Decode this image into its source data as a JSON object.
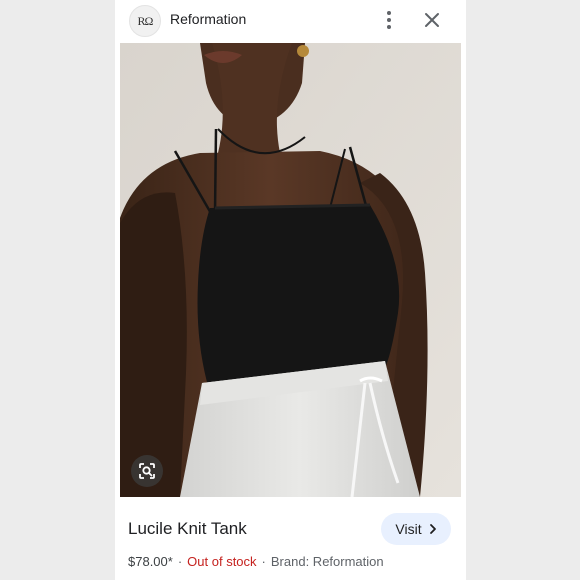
{
  "header": {
    "logo_text": "RΩ",
    "source_name": "Reformation"
  },
  "product": {
    "title": "Lucile Knit Tank",
    "price": "$78.00*",
    "stock_status": "Out of stock",
    "brand": "Brand: Reformation",
    "separator": "·"
  },
  "actions": {
    "visit_label": "Visit"
  },
  "icons": {
    "more": "more-vert-icon",
    "close": "close-icon",
    "lens": "lens-search-icon",
    "visit_chevron": "chevron-right-icon"
  },
  "colors": {
    "out_of_stock": "#c5221f",
    "visit_bg": "#e8f0fe",
    "text_primary": "#202124",
    "text_secondary": "#5f6368"
  }
}
